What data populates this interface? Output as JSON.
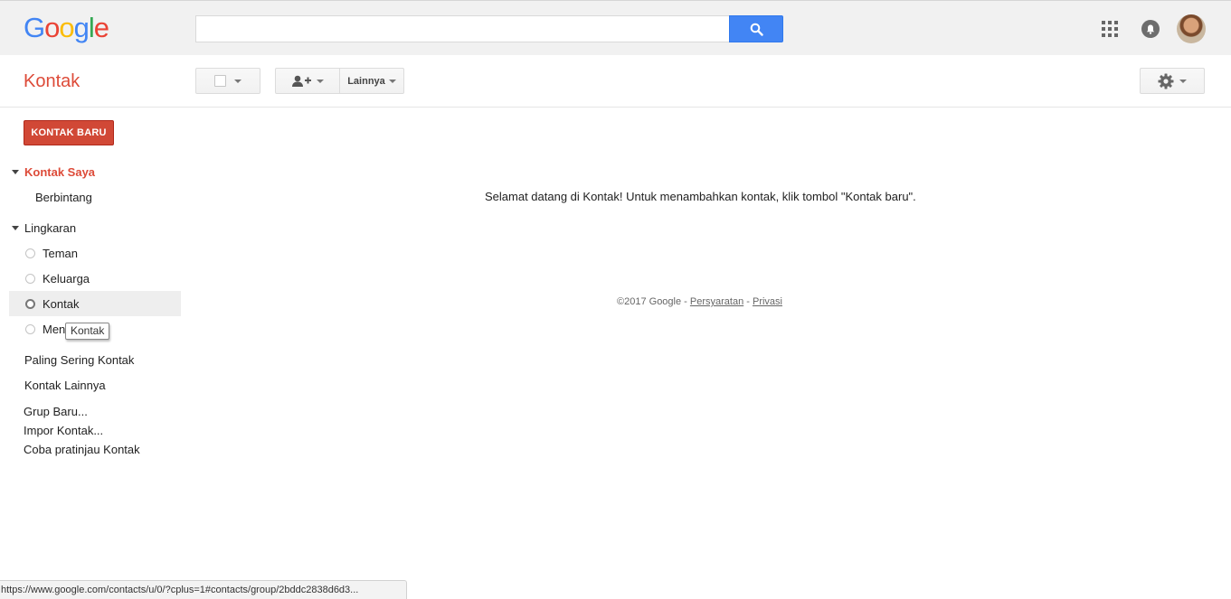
{
  "header": {
    "logo_letters": [
      {
        "ch": "G",
        "color": "#4285f4"
      },
      {
        "ch": "o",
        "color": "#ea4335"
      },
      {
        "ch": "o",
        "color": "#fbbc05"
      },
      {
        "ch": "g",
        "color": "#4285f4"
      },
      {
        "ch": "l",
        "color": "#34a853"
      },
      {
        "ch": "e",
        "color": "#ea4335"
      }
    ],
    "search_value": "",
    "search_icon": "search-icon",
    "apps_icon": "apps-grid-icon",
    "notifications_icon": "notifications-bell-icon"
  },
  "toolbar": {
    "app_title": "Kontak",
    "more_label": "Lainnya",
    "settings_icon": "gear-icon",
    "add_contact_icon": "add-person-icon"
  },
  "sidebar": {
    "new_contact_label": "KONTAK BARU",
    "my_contacts_label": "Kontak Saya",
    "starred_label": "Berbintang",
    "circles_label": "Lingkaran",
    "circle_items": [
      "Teman",
      "Keluarga",
      "Kontak",
      "Men"
    ],
    "selected_circle": "Kontak",
    "tooltip_text": "Kontak",
    "most_contacted_label": "Paling Sering Kontak",
    "other_contacts_label": "Kontak Lainnya",
    "new_group_label": "Grup Baru...",
    "import_label": "Impor Kontak...",
    "preview_label": "Coba pratinjau Kontak"
  },
  "main": {
    "welcome_text": "Selamat datang di Kontak! Untuk menambahkan kontak, klik tombol \"Kontak baru\".",
    "footer_copyright": "©2017 Google - ",
    "footer_terms": "Persyaratan",
    "footer_sep": " - ",
    "footer_privacy": "Privasi"
  },
  "statusbar": {
    "url": "https://www.google.com/contacts/u/0/?cplus=1#contacts/group/2bddc2838d6d3..."
  },
  "colors": {
    "brand_red": "#dd4b39",
    "button_red": "#d14836",
    "search_blue": "#4285f4"
  }
}
